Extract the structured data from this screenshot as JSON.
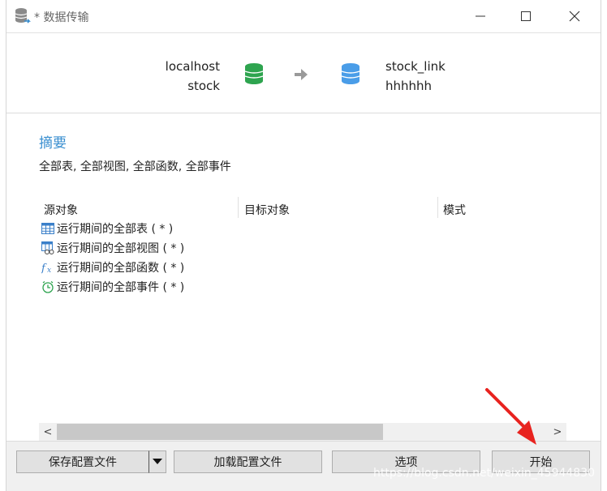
{
  "window": {
    "title": "* 数据传输"
  },
  "connection": {
    "source_host": "localhost",
    "source_db": "stock",
    "target_host": "stock_link",
    "target_db": "hhhhhh",
    "source_color": "#2ea44f",
    "target_color": "#4a9de8",
    "icons": [
      "database-icon",
      "arrow-right-icon",
      "database-icon"
    ]
  },
  "summary": {
    "title": "摘要",
    "text": "全部表, 全部视图, 全部函数, 全部事件"
  },
  "table": {
    "columns": [
      "源对象",
      "目标对象",
      "模式"
    ],
    "rows": [
      {
        "icon": "table-icon",
        "label": "运行期间的全部表 ( * )"
      },
      {
        "icon": "view-icon",
        "label": "运行期间的全部视图 ( * )"
      },
      {
        "icon": "function-icon",
        "label": "运行期间的全部函数 ( * )"
      },
      {
        "icon": "clock-icon",
        "label": "运行期间的全部事件 ( * )"
      }
    ]
  },
  "scrollbar": {
    "left_arrow": "<",
    "right_arrow": ">"
  },
  "footer": {
    "save_config": "保存配置文件",
    "load_config": "加载配置文件",
    "options": "选项",
    "start": "开始"
  },
  "watermark": "https://blog.csdn.net/weixin_45944830",
  "accent_color": "#3a8fd0"
}
